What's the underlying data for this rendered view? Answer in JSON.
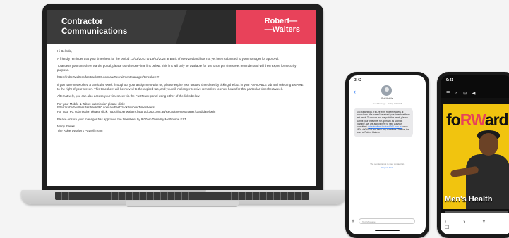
{
  "banner": {
    "title_line1": "Contractor",
    "title_line2": "Communications",
    "brand_line1": "Robert—",
    "brand_line2": "—Walters",
    "colors": {
      "dark": "#3b3b3b",
      "accent": "#e8425a"
    }
  },
  "email": {
    "greeting": "Hi Belinda,",
    "p1": "A friendly reminder that your timesheet for the period 13/03/2023 to 19/03/2023 at Bank of New Zealand has not yet been submitted to your manager for approval.",
    "p2": "To access your timesheet via the portal, please use the one-time link below. This link will only be available for use once per timesheet reminder and will then expire for security purpose.",
    "link1": "https://robertwalters.fasttrack360.com.au/RecruitmentManager/timesheet#",
    "p3": "If you have not worked a particular week throughout your assignment with us, please expire your unused timesheet by ticking the box in your AVAILABLE tab and selecting EXPIRE to the right of your screen. This timesheet will be moved to the expired tab, and you will no longer receive reminders to enter hours for that particular timesheet/week.",
    "p4": "Alternatively, you can also access your timesheet via the FastTrack portal using either of the links below:",
    "mobile_label": "For your Mobile & Tablet submission please click:",
    "mobile_link": "https://robertwalters.fasttrack360.com.au/FastTrack.Mobile/Timesheets",
    "pc_line": "For your PC submission please click: https://robertwalters.fasttrack360.com.au/RecruitmentManager/candidatelogin",
    "p5": "Please ensure your manager has approved the timesheet by 9:00am Tuesday Melbourne EST.",
    "signoff": "Many thanks",
    "team": "The Robert Walters Payroll Team"
  },
  "messages": {
    "status_time": "3:42",
    "back_glyph": "‹",
    "contact": "Bot Mobile",
    "meta": "Text Message · Today 3:04 PM",
    "bubble_text": "Kia ora Belinda, It's Lee from Robert Walters at iconsulants. We haven't received your timesheet from last week. To ensure you are paid this week, please submit your timesheet for approval as soon as possible. We are always here to help via your consultant.",
    "bubble_link": "robertwalters.fasttrack360.com.au",
    "bubble_tail": "or on 0800 400 600 if you have any questions. Thanks, the team at Robert Walters",
    "stop_text": "The sender is not in your contact list.",
    "stop_link": "Report Junk",
    "compose_placeholder": "Text Message",
    "camera_glyph": "◉"
  },
  "magazine": {
    "status_time": "9:41",
    "top_icons": "☰ ⌕ ⊞ ◀",
    "masthead_pre": "fo",
    "masthead_mid": "RW",
    "masthead_post": "ard",
    "cover_headline": "Men's Health",
    "nav_icons": "‹ › ⇪ ☐",
    "colors": {
      "cover": "#f1c40f",
      "accent": "#e8425a"
    }
  }
}
